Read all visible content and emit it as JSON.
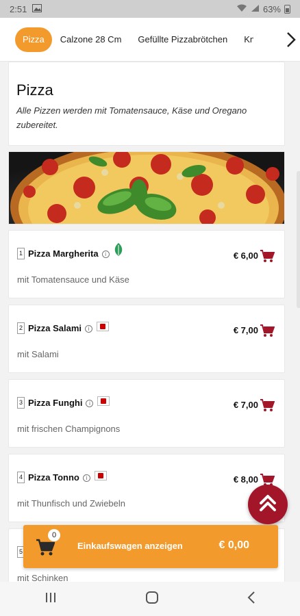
{
  "status": {
    "time": "2:51",
    "battery": "63%"
  },
  "categories": [
    "Pizza",
    "Calzone 28 Cm",
    "Gefüllte Pizzabrötchen",
    "Kn"
  ],
  "section": {
    "title": "Pizza",
    "description": "Alle Pizzen werden mit Tomatensauce, Käse und Oregano zubereitet."
  },
  "items": [
    {
      "num": "1",
      "name": "Pizza Margherita",
      "price": "€ 6,00",
      "desc": "mit Tomatensauce und Käse",
      "badge": "vegetarian-leaf-icon"
    },
    {
      "num": "2",
      "name": "Pizza Salami",
      "price": "€ 7,00",
      "desc": "mit Salami",
      "badge": "meat-icon"
    },
    {
      "num": "3",
      "name": "Pizza Funghi",
      "price": "€ 7,00",
      "desc": "mit frischen Champignons",
      "badge": "meat-icon"
    },
    {
      "num": "4",
      "name": "Pizza Tonno",
      "price": "€ 8,00",
      "desc": "mit Thunfisch und Zwiebeln",
      "badge": "meat-icon"
    },
    {
      "num": "5",
      "name": "",
      "price": "",
      "desc": "mit Schinken",
      "badge": ""
    }
  ],
  "cart": {
    "count": "0",
    "label": "Einkaufswagen anzeigen",
    "total": "€ 0,00"
  },
  "colors": {
    "accent": "#f39a2c",
    "cart_red": "#a3162a",
    "leaf_green": "#2e9c5a"
  }
}
